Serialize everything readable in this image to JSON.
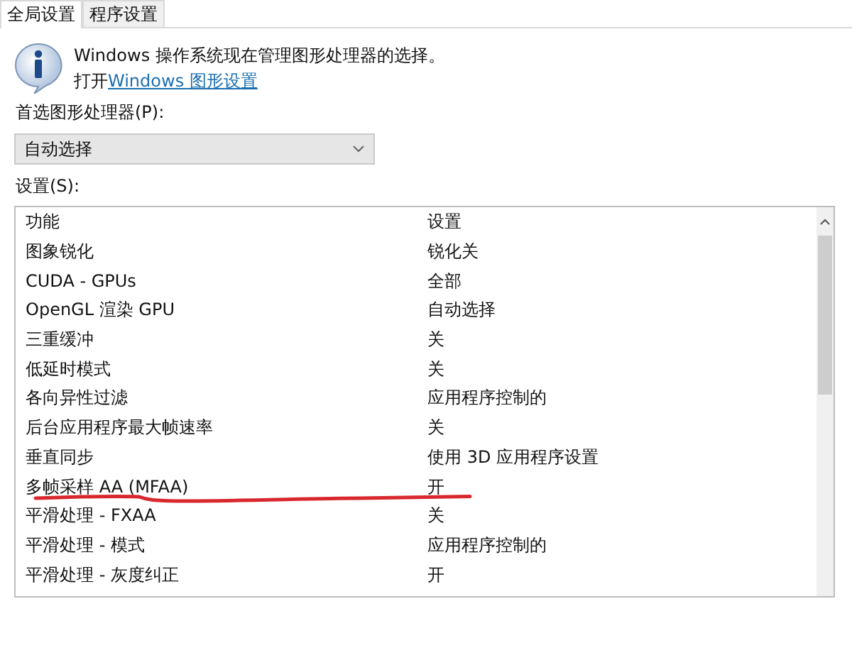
{
  "tabs": [
    {
      "label": "全局设置",
      "selected": true
    },
    {
      "label": "程序设置",
      "selected": false
    }
  ],
  "info": {
    "message": "Windows 操作系统现在管理图形处理器的选择。",
    "link_prefix": "打开",
    "link": "Windows 图形设置"
  },
  "processor": {
    "label": "首选图形处理器(P):",
    "value": "自动选择"
  },
  "settings": {
    "label": "设置(S):",
    "columns": [
      "功能",
      "设置"
    ],
    "rows": [
      {
        "feature": "图象锐化",
        "setting": "锐化关",
        "marked": false
      },
      {
        "feature": "CUDA - GPUs",
        "setting": "全部",
        "marked": false
      },
      {
        "feature": "OpenGL 渲染 GPU",
        "setting": "自动选择",
        "marked": false
      },
      {
        "feature": "三重缓冲",
        "setting": "关",
        "marked": false
      },
      {
        "feature": "低延时模式",
        "setting": "关",
        "marked": false
      },
      {
        "feature": "各向异性过滤",
        "setting": "应用程序控制的",
        "marked": false
      },
      {
        "feature": "后台应用程序最大帧速率",
        "setting": "关",
        "marked": false
      },
      {
        "feature": "垂直同步",
        "setting": "使用 3D 应用程序设置",
        "marked": false
      },
      {
        "feature": "多帧采样 AA (MFAA)",
        "setting": "开",
        "marked": true
      },
      {
        "feature": "平滑处理 - FXAA",
        "setting": "关",
        "marked": false
      },
      {
        "feature": "平滑处理 - 模式",
        "setting": "应用程序控制的",
        "marked": false
      },
      {
        "feature": "平滑处理 - 灰度纠正",
        "setting": "开",
        "marked": false
      }
    ]
  }
}
